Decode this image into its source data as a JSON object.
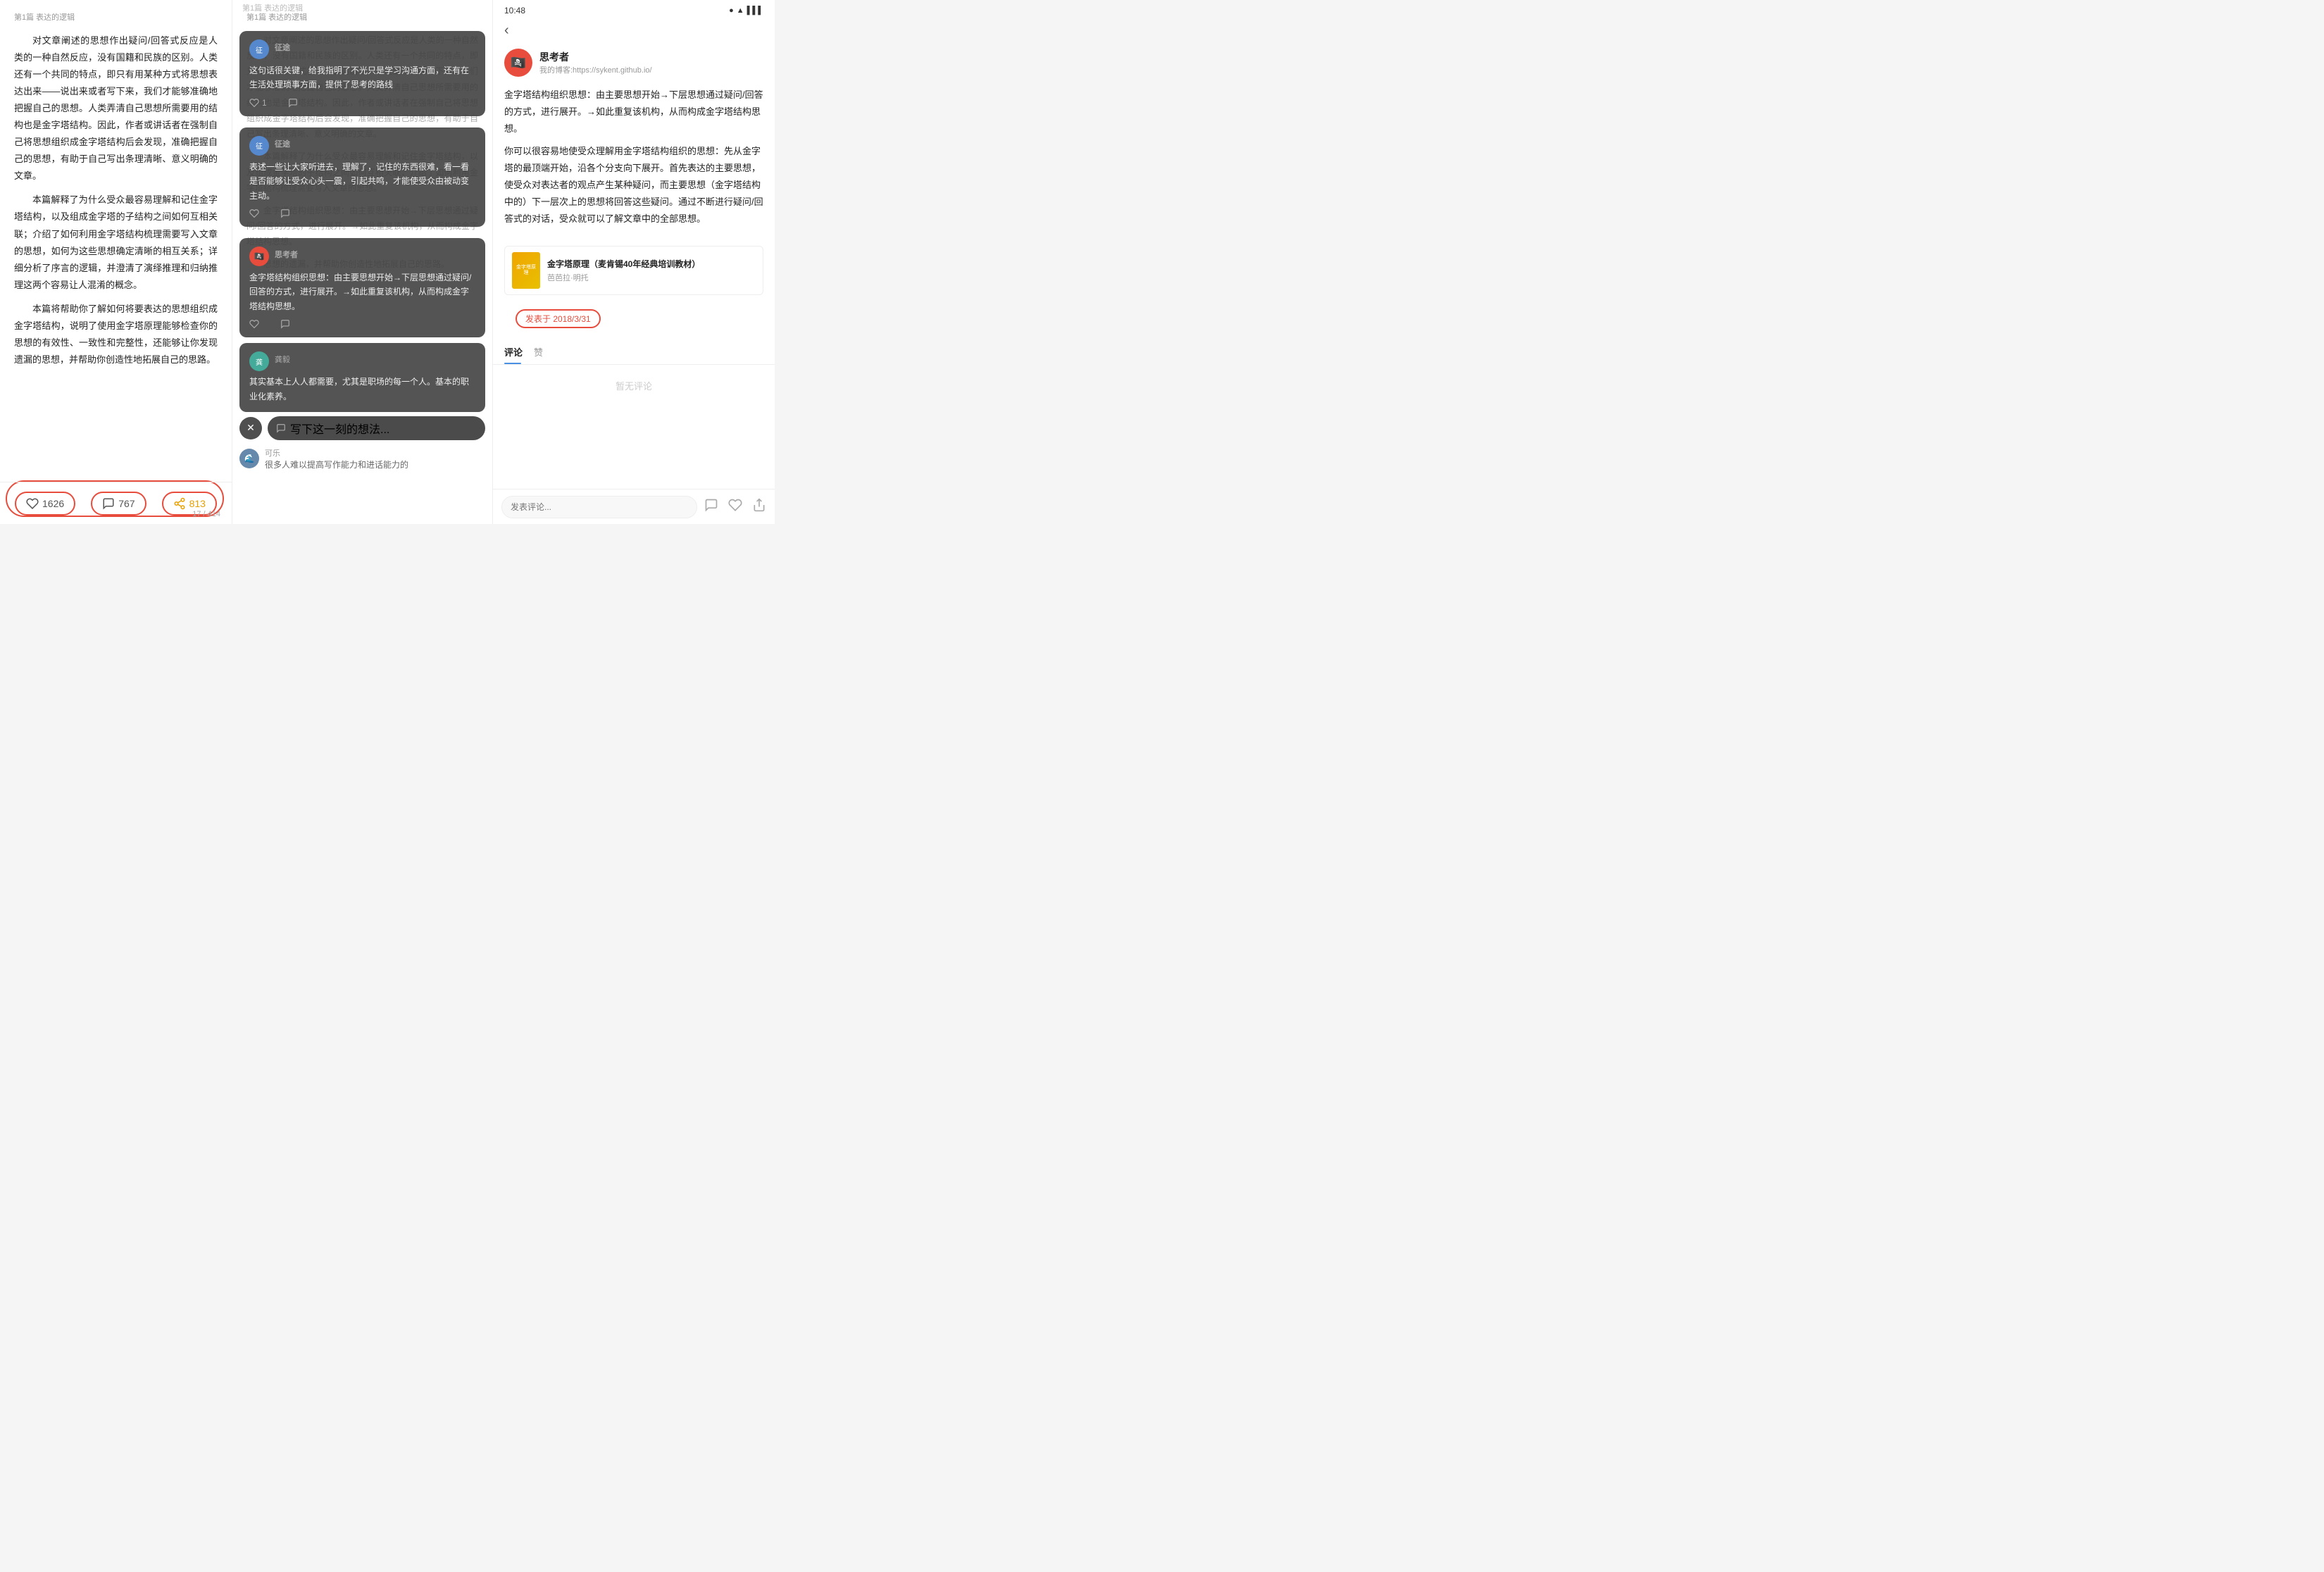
{
  "panel1": {
    "header": "第1篇 表达的逻辑",
    "paragraphs": [
      "对文章阐述的思想作出疑问/回答式反应是人类的一种自然反应，没有国籍和民族的区别。人类还有一个共同的特点，即只有用某种方式将思想表达出来——说出来或者写下来，我们才能够准确地把握自己的思想。人类弄清自己思想所需要用的结构也是金字塔结构。因此，作者或讲话者在强制自己将思想组织成金字塔结构后会发现，准确把握自己的思想，有助于自己写出条理清晰、意义明确的文章。",
      "本篇解释了为什么受众最容易理解和记住金字塔结构，以及组成金字塔的子结构之间如何互相关联；介绍了如何利用金字塔结构梳理需要写入文章的思想，如何为这些思想确定清晰的相互关系；详细分析了序言的逻辑，并澄清了演绎推理和归纳推理这两个容易让人混淆的概念。",
      "本篇将帮助你了解如何将要表达的思想组织成金字塔结构，说明了使用金字塔原理能够检查你的思想的有效性、一致性和完整性，还能够让你发现遗漏的思想，并帮助你创造性地拓展自己的思路。"
    ],
    "likes_count": "1626",
    "comments_count": "767",
    "shares_count": "813",
    "page_indicator": "17 / 414"
  },
  "panel2": {
    "header": "第1篇 表达的逻辑",
    "bg_paragraphs": [
      "对文章阐述的思想作出疑问/回答式反应是人类的一种自然反应，没有国籍和民族的区别。人类还有一个共同的特点，即只有用某种方式将思想表达出来——说出来或者写下来，我们才能够准确地把握自己的思想。人类弄清自己思想所需要用的结构也是金字塔结构。因此，作者或讲话者在强制自己将思想组织成金字塔结构后会发现，准确把握自己的思想，有助于自己写出条理清晰、意义明确的文章。",
      "本篇解释了为什么受众最容易理解和记住金字塔结构，以及组成金字塔的子结构之间如何互相关联；介绍了如何利用金字塔结构梳理需要写入文章的思想。",
      "金字塔结构组织思想：由主要思想开始→下层思想通过疑问/回答的方式，进行展开。→如此重复该机构，从而构成金字塔结构思想。",
      "思想的遗漏，并帮助你创造性地拓展自己的思路。"
    ],
    "comments": [
      {
        "author": "征途",
        "body": "这句话很关键，给我指明了不光只是学习沟通方面，还有在生活处理琐事方面，提供了思考的路线",
        "likes": "1",
        "has_reply": true
      },
      {
        "author": "征途",
        "body": "表述一些让大家听进去，理解了，记住的东西很难，看一看是否能够让受众心头一震，引起共鸣，才能使受众由被动变主动。",
        "likes": "",
        "has_reply": true
      },
      {
        "author": "思考者",
        "body": "金字塔结构组织思想：由主要思想开始→下层思想通过疑问/回答的方式，进行展开。→如此重复该机构，从而构成金字塔结构思想。",
        "likes": "",
        "has_reply": true
      }
    ],
    "partial_comment": {
      "author": "龚毅",
      "body": "其实基本上人人都需要，尤其是职场的每一个人。基本的职业化素养。"
    },
    "compose_placeholder": "写下这一刻的想法...",
    "partial_author2": "可乐",
    "partial_body2": "很多人难以提高写作能力和进话能力的"
  },
  "panel3": {
    "status_time": "10:48",
    "author_name": "思考者",
    "author_url": "我的博客:https://sykent.github.io/",
    "article_text1": "金字塔结构组织思想：由主要思想开始→下层思想通过疑问/回答的方式，进行展开。→如此重复该机构，从而构成金字塔结构思想。",
    "article_text2": "你可以很容易地使受众理解用金字塔结构组织的思想：先从金字塔的最顶端开始，沿各个分支向下展开。首先表达的主要思想，使受众对表达者的观点产生某种疑问，而主要思想（金字塔结构中的）下一层次上的思想将回答这些疑问。通过不断进行疑问/回答式的对话，受众就可以了解文章中的全部思想。",
    "book_title": "金字塔原理（麦肯锡40年经典培训教材）",
    "book_author": "芭芭拉·明托",
    "publish_date": "发表于 2018/3/31",
    "tabs": [
      "评论",
      "赞"
    ],
    "active_tab": "评论",
    "no_comment": "暂无评论",
    "compose_placeholder": "发表评论...",
    "back_icon": "‹"
  }
}
